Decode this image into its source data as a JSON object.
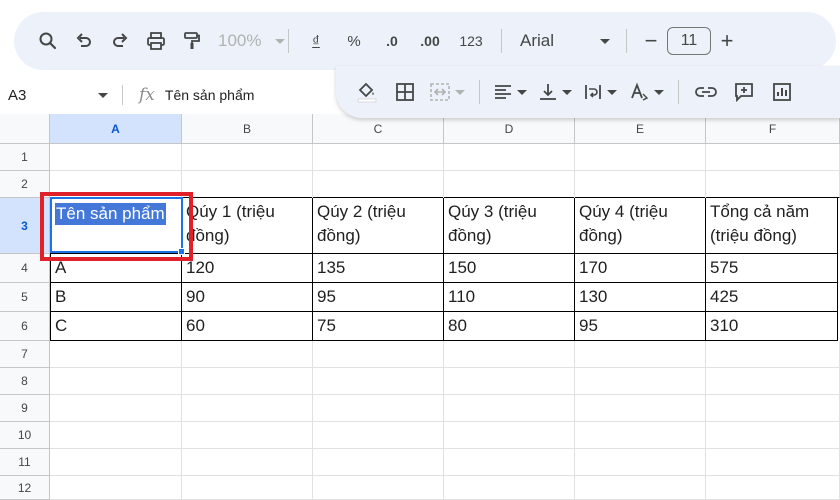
{
  "toolbar": {
    "zoom": "100%",
    "format_currency": "₫",
    "format_percent": "%",
    "format_dec_decrease": ".0",
    "format_dec_increase": ".00",
    "format_number": "123",
    "font": "Arial",
    "font_size": "11",
    "minus": "−",
    "plus": "+"
  },
  "formula_bar": {
    "cell_ref": "A3",
    "fx": "fx",
    "content": "Tên sản phẩm"
  },
  "columns": [
    "A",
    "B",
    "C",
    "D",
    "E",
    "F"
  ],
  "rows": [
    "1",
    "2",
    "3",
    "4",
    "5",
    "6",
    "7",
    "8",
    "9",
    "10",
    "11",
    "12"
  ],
  "table": {
    "header": {
      "a": "Tên sản phẩm",
      "b": "Qúy 1 (triệu đồng)",
      "c": "Qúy 2 (triệu đồng)",
      "d": "Qúy 3 (triệu đồng)",
      "e": "Qúy 4 (triệu đồng)",
      "f": "Tổng cả năm (triệu đồng)"
    },
    "rows": [
      {
        "a": "A",
        "b": "120",
        "c": "135",
        "d": "150",
        "e": "170",
        "f": "575"
      },
      {
        "a": "B",
        "b": "90",
        "c": "95",
        "d": "110",
        "e": "130",
        "f": "425"
      },
      {
        "a": "C",
        "b": "60",
        "c": "75",
        "d": "80",
        "e": "95",
        "f": "310"
      }
    ]
  },
  "selection": {
    "color": "#1a73e8",
    "highlight": "#e0202a"
  }
}
